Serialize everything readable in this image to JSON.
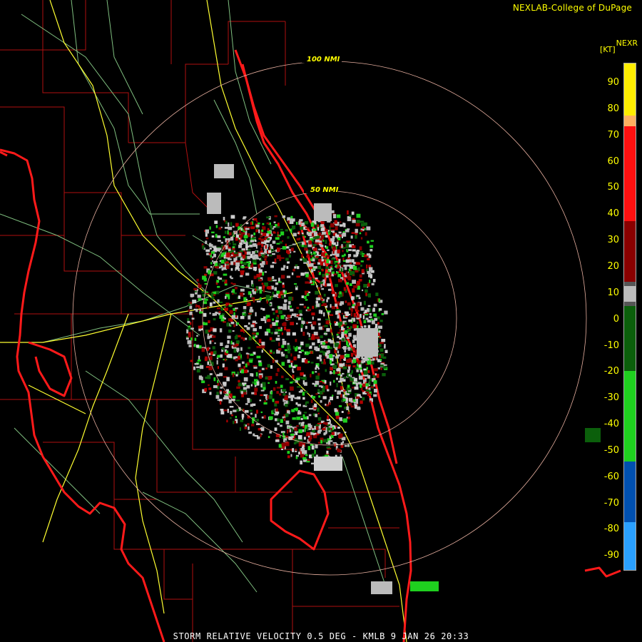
{
  "header": {
    "credit": "NEXLAB-College of DuPage",
    "product": "NEXR",
    "units": "[KT]"
  },
  "footer": {
    "caption": "STORM RELATIVE VELOCITY 0.5 DEG - KMLB 9 JAN 26 20:33"
  },
  "range_rings": [
    {
      "label": "50 NMI"
    },
    {
      "label": "100 NMI"
    }
  ],
  "colorbar": {
    "ticks": [
      "90",
      "80",
      "70",
      "60",
      "50",
      "40",
      "30",
      "20",
      "10",
      "0",
      "-10",
      "-20",
      "-30",
      "-40",
      "-50",
      "-60",
      "-70",
      "-80",
      "-90"
    ],
    "segments": [
      {
        "color": "#ffee00",
        "weight": 1.2
      },
      {
        "color": "#ffb060",
        "weight": 0.25
      },
      {
        "color": "#ff1010",
        "weight": 2.2
      },
      {
        "color": "#8a0000",
        "weight": 1.4
      },
      {
        "color": "#555555",
        "weight": 0.1
      },
      {
        "color": "#bbbbbb",
        "weight": 0.35
      },
      {
        "color": "#555555",
        "weight": 0.1
      },
      {
        "color": "#0b5f0b",
        "weight": 1.5
      },
      {
        "color": "#1fd01f",
        "weight": 2.1
      },
      {
        "color": "#0050b0",
        "weight": 1.4
      },
      {
        "color": "#2aa0ff",
        "weight": 1.1
      }
    ]
  },
  "colors": {
    "coast": "#ff1a1a",
    "county": "#b01010",
    "highway": "#ffff30",
    "road": "#80c080",
    "ring": "#e8b0a0"
  }
}
